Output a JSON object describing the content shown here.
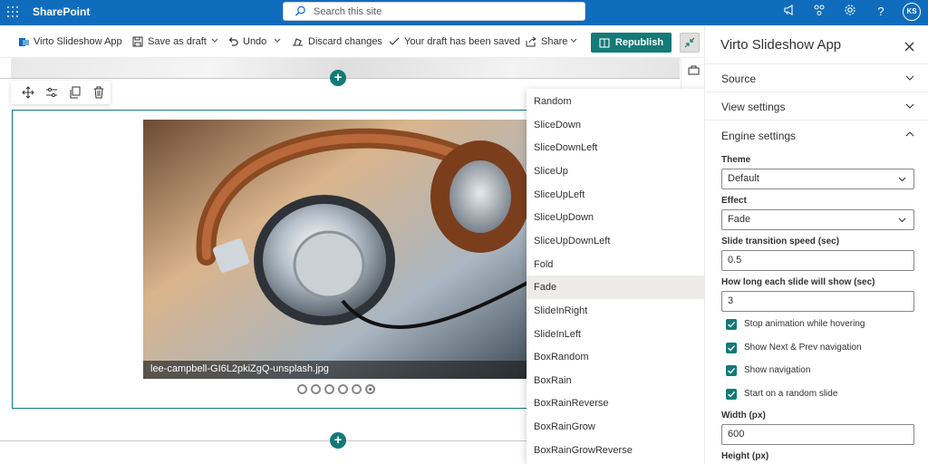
{
  "suitebar": {
    "brand": "SharePoint",
    "search_placeholder": "Search this site",
    "user_initials": "KS"
  },
  "commandbar": {
    "app_name": "Virto Slideshow App",
    "save_draft": "Save as draft",
    "undo": "Undo",
    "discard": "Discard changes",
    "draft_status": "Your draft has been saved",
    "share": "Share",
    "republish": "Republish"
  },
  "slideshow": {
    "caption": "lee-campbell-GI6L2pkiZgQ-unsplash.jpg",
    "dot_count": 6,
    "active_dot": 6
  },
  "effect_dropdown": {
    "options": [
      "Random",
      "SliceDown",
      "SliceDownLeft",
      "SliceUp",
      "SliceUpLeft",
      "SliceUpDown",
      "SliceUpDownLeft",
      "Fold",
      "Fade",
      "SlideInRight",
      "SlideInLeft",
      "BoxRandom",
      "BoxRain",
      "BoxRainReverse",
      "BoxRainGrow",
      "BoxRainGrowReverse"
    ],
    "selected": "Fade"
  },
  "panel": {
    "title": "Virto Slideshow App",
    "sections": {
      "source": "Source",
      "view": "View settings",
      "engine": "Engine settings"
    },
    "theme_label": "Theme",
    "theme_value": "Default",
    "effect_label": "Effect",
    "effect_value": "Fade",
    "speed_label": "Slide transition speed (sec)",
    "speed_value": "0.5",
    "duration_label": "How long each slide will show (sec)",
    "duration_value": "3",
    "checkboxes": [
      {
        "label": "Stop animation while hovering",
        "checked": true
      },
      {
        "label": "Show Next & Prev navigation",
        "checked": true
      },
      {
        "label": "Show navigation",
        "checked": true
      },
      {
        "label": "Start on a random slide",
        "checked": true
      }
    ],
    "width_label": "Width (px)",
    "width_value": "600",
    "height_label": "Height (px)"
  },
  "colors": {
    "suitebar": "#0f6cbd",
    "accent": "#127a78"
  }
}
